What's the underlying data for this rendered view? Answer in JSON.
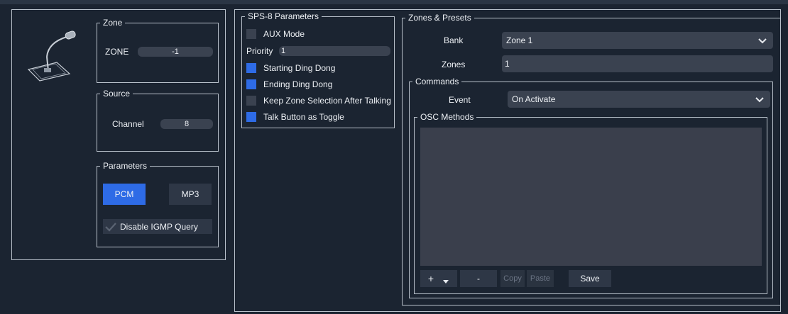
{
  "left": {
    "zone": {
      "legend": "Zone",
      "label": "ZONE",
      "value": "-1"
    },
    "source": {
      "legend": "Source",
      "label": "Channel",
      "value": "8"
    },
    "parameters": {
      "legend": "Parameters",
      "pcm_label": "PCM",
      "mp3_label": "MP3",
      "igmp_label": "Disable IGMP Query",
      "selected": "PCM"
    }
  },
  "sps": {
    "legend": "SPS-8 Parameters",
    "aux_label": "AUX Mode",
    "priority_label": "Priority",
    "priority_value": "1",
    "options": [
      {
        "label": "Starting Ding Dong",
        "checked": true
      },
      {
        "label": "Ending Ding Dong",
        "checked": true
      },
      {
        "label": "Keep Zone Selection After Talking",
        "checked": false
      },
      {
        "label": "Talk Button as Toggle",
        "checked": true
      }
    ]
  },
  "zones_presets": {
    "legend": "Zones & Presets",
    "bank_label": "Bank",
    "bank_value": "Zone 1",
    "zones_label": "Zones",
    "zones_value": "1",
    "commands": {
      "legend": "Commands",
      "event_label": "Event",
      "event_value": "On Activate",
      "osc": {
        "legend": "OSC Methods",
        "buttons": {
          "add": "+",
          "remove": "-",
          "copy": "Copy",
          "paste": "Paste",
          "save": "Save"
        }
      }
    }
  },
  "colors": {
    "accent": "#2e6be6",
    "background": "#1b2431",
    "field": "#3a4250"
  },
  "icons": [
    "microphone-icon",
    "chevron-down-icon",
    "dropdown-arrow-icon",
    "checkmark-icon"
  ]
}
